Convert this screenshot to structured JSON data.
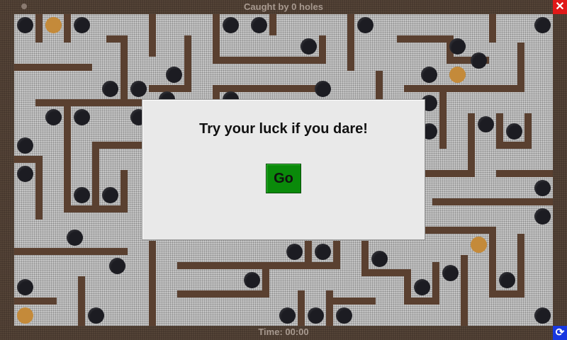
{
  "header": {
    "caught_text": "Caught by 0 holes",
    "close_glyph": "✕"
  },
  "footer": {
    "time_text": "Time: 00:00",
    "restart_glyph": "⟳"
  },
  "dialog": {
    "message": "Try your luck if you dare!",
    "go_label": "Go"
  },
  "colors": {
    "frame": "#43352b",
    "board": "#c8c8c8",
    "wall": "#5a4030",
    "hole": "#1c1c22",
    "ball": "#c48a3a",
    "go": "#0a8a0a",
    "close": "#e01818",
    "restart": "#1838e0"
  },
  "icons": {
    "close": "close-icon",
    "restart": "restart-icon",
    "menu": "menu-dot-icon"
  }
}
